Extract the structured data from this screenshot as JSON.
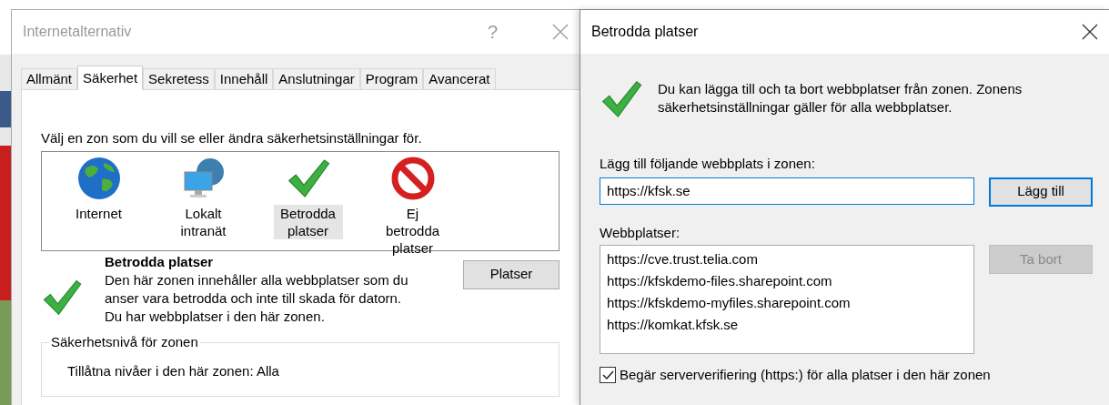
{
  "left_window": {
    "title": "Internetalternativ",
    "help": "?",
    "tabs": [
      {
        "label": "Allmänt",
        "selected": false
      },
      {
        "label": "Säkerhet",
        "selected": true
      },
      {
        "label": "Sekretess",
        "selected": false
      },
      {
        "label": "Innehåll",
        "selected": false
      },
      {
        "label": "Anslutningar",
        "selected": false
      },
      {
        "label": "Program",
        "selected": false
      },
      {
        "label": "Avancerat",
        "selected": false
      }
    ],
    "zone_prompt": "Välj en zon som du vill se eller ändra säkerhetsinställningar för.",
    "zones": [
      {
        "kind": "globe",
        "label": "Internet",
        "selected": false
      },
      {
        "kind": "intranet",
        "label": "Lokalt intranät",
        "selected": false
      },
      {
        "kind": "trusted",
        "label": "Betrodda platser",
        "selected": true
      },
      {
        "kind": "restricted",
        "label": "Ej betrodda platser",
        "selected": false
      }
    ],
    "zone_title": "Betrodda platser",
    "zone_description": "Den här zonen innehåller alla webbplatser som du anser vara betrodda och inte till skada för datorn.",
    "zone_status": "Du har webbplatser i den här zonen.",
    "sites_button": "Platser",
    "security_group": {
      "title": "Säkerhetsnivå för zonen",
      "text": "Tillåtna nivåer i den här zonen: Alla"
    }
  },
  "right_window": {
    "title": "Betrodda platser",
    "info": "Du kan lägga till och ta bort webbplatser från zonen. Zonens säkerhetsinställningar gäller för alla webbplatser.",
    "add_label": "Lägg till följande webbplats i zonen:",
    "add_value": "https://kfsk.se",
    "add_button": {
      "label": "Lägg till",
      "disabled": false
    },
    "list_label": "Webbplatser:",
    "sites": [
      "https://cve.trust.telia.com",
      "https://kfskdemo-files.sharepoint.com",
      "https://kfskdemo-myfiles.sharepoint.com",
      "https://komkat.kfsk.se"
    ],
    "remove_button": {
      "label": "Ta bort",
      "disabled": true
    },
    "https_check": {
      "label": "Begär serververifiering (https:) för alla platser i den här zonen",
      "checked": true
    }
  }
}
